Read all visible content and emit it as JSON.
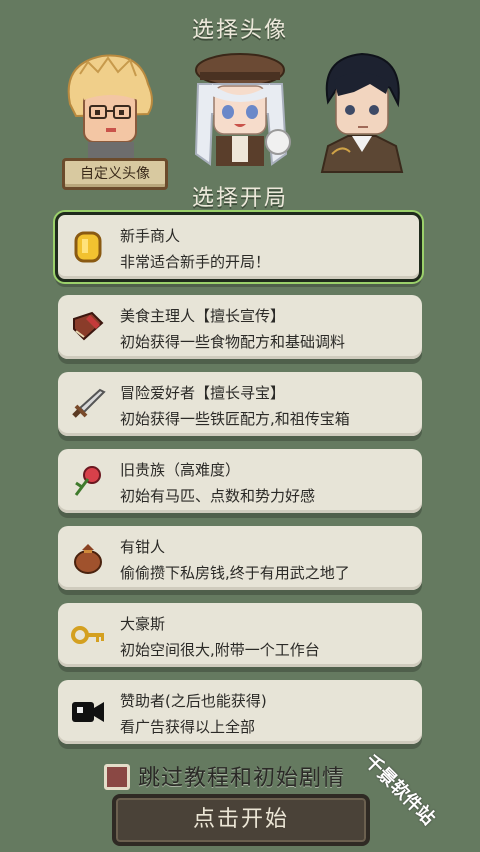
{
  "titles": {
    "choose_avatar": "选择头像",
    "choose_start": "选择开局"
  },
  "avatars": [
    {
      "name": "blonde-boy-avatar",
      "label": "自定义头像"
    },
    {
      "name": "white-hair-girl-avatar"
    },
    {
      "name": "black-hair-boy-avatar"
    }
  ],
  "options": [
    {
      "name": "新手商人",
      "desc": "非常适合新手的开局！",
      "icon": "gold-coin-icon",
      "selected": true
    },
    {
      "name": "美食主理人【擅长宣传】",
      "desc": "初始获得一些食物配方和基础调料",
      "icon": "recipe-book-icon"
    },
    {
      "name": "冒险爱好者【擅长寻宝】",
      "desc": "初始获得一些铁匠配方,和祖传宝箱",
      "icon": "sword-icon"
    },
    {
      "name": "旧贵族（高难度）",
      "desc": "初始有马匹、点数和势力好感",
      "icon": "rose-icon"
    },
    {
      "name": "有钳人",
      "desc": "偷偷攒下私房钱,终于有用武之地了",
      "icon": "money-bag-icon"
    },
    {
      "name": "大豪斯",
      "desc": "初始空间很大,附带一个工作台",
      "icon": "key-icon"
    },
    {
      "name": "赞助者(之后也能获得)",
      "desc": "看广告获得以上全部",
      "icon": "video-camera-icon"
    }
  ],
  "skip_label": "跳过教程和初始剧情",
  "start_button": "点击开始",
  "watermark": "千景软件站"
}
